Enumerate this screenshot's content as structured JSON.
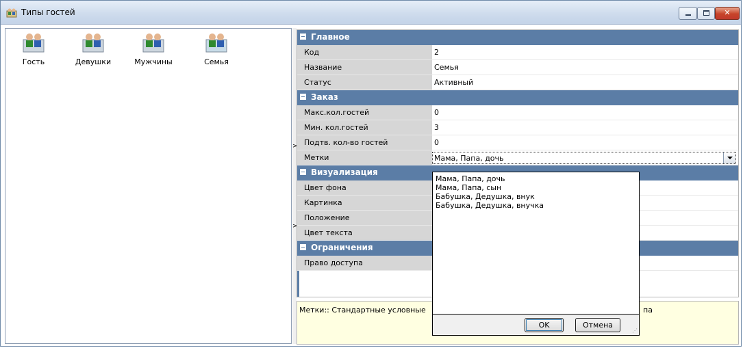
{
  "window": {
    "title": "Типы гостей",
    "icon": "guests-icon",
    "controls": [
      "minimize-icon",
      "maximize-icon",
      "close-icon"
    ]
  },
  "types": [
    {
      "label": "Гость"
    },
    {
      "label": "Девушки"
    },
    {
      "label": "Мужчины"
    },
    {
      "label": "Семья"
    }
  ],
  "properties": {
    "main": {
      "title": "Главное",
      "rows": [
        {
          "key": "Код",
          "value": "2"
        },
        {
          "key": "Название",
          "value": "Семья"
        },
        {
          "key": "Статус",
          "value": "Активный"
        }
      ]
    },
    "order": {
      "title": "Заказ",
      "rows": [
        {
          "key": "Макс.кол.гостей",
          "value": "0"
        },
        {
          "key": "Мин. кол.гостей",
          "value": "3"
        },
        {
          "key": "Подтв. кол-во гостей",
          "value": "0"
        },
        {
          "key": "Метки",
          "value": "Мама, Папа, дочь"
        }
      ]
    },
    "visual": {
      "title": "Визуализация",
      "rows": [
        {
          "key": "Цвет фона"
        },
        {
          "key": "Картинка"
        },
        {
          "key": "Положение"
        },
        {
          "key": "Цвет текста"
        }
      ]
    },
    "limits": {
      "title": "Ограничения",
      "rows": [
        {
          "key": "Право доступа"
        }
      ]
    }
  },
  "description": {
    "text": "Метки:: Стандартные условные",
    "tail": "па"
  },
  "dropdown": {
    "options": [
      "Мама, Папа, дочь",
      "Мама, Папа, сын",
      "Бабушка, Дедушка, внук",
      "Бабушка, Дедушка, внучка"
    ],
    "ok_label": "OK",
    "cancel_label": "Отмена"
  },
  "colors": {
    "category_header": "#5b7da6",
    "key_cell": "#d6d6d6",
    "description_bg": "#ffffe1"
  }
}
